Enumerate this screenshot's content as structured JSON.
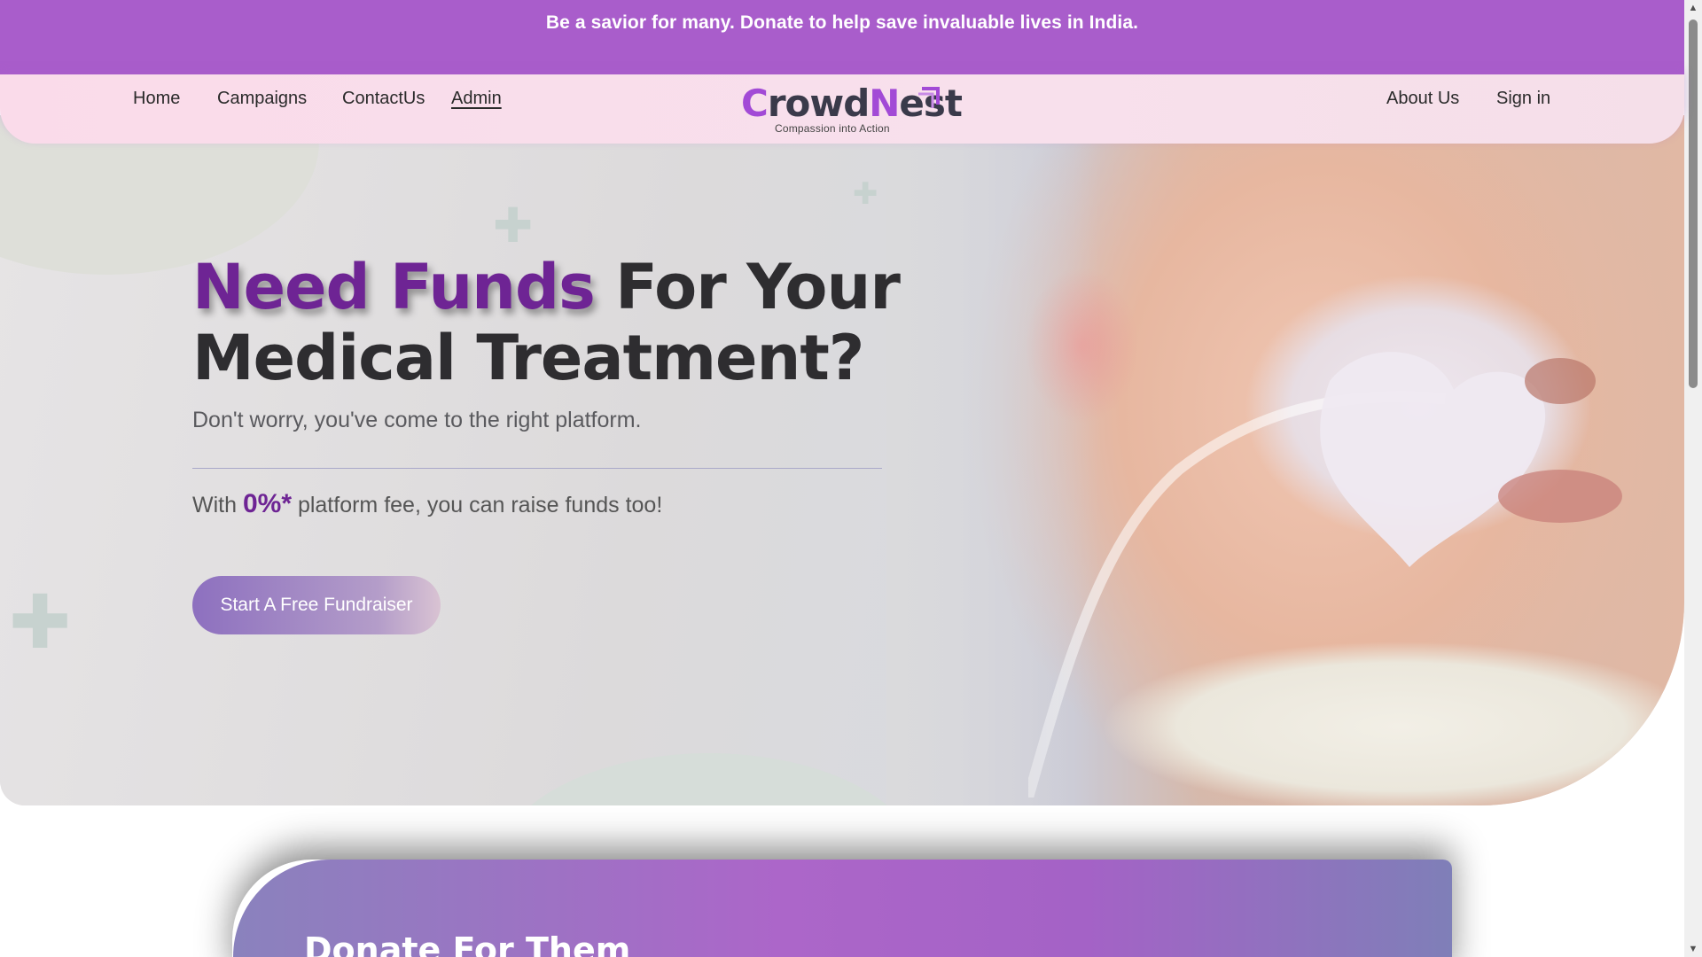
{
  "announcement": {
    "text": "Be a savior for many. Donate to help save invaluable lives in India."
  },
  "nav": {
    "left": [
      {
        "label": "Home"
      },
      {
        "label": "Campaigns"
      },
      {
        "label": "ContactUs"
      },
      {
        "label": "Admin",
        "active": true
      }
    ],
    "right": [
      {
        "label": "About Us"
      },
      {
        "label": "Sign in"
      }
    ]
  },
  "logo": {
    "c": "C",
    "rowd": "rowd",
    "n": "N",
    "est": "est",
    "tagline": "Compassion into Action"
  },
  "hero": {
    "title_accent": "Need Funds",
    "title_rest_1": " For Your",
    "title_line2": "Medical Treatment?",
    "subtitle": "Don't worry, you've come to the right platform.",
    "fee_prefix": "With ",
    "fee_value": "0%*",
    "fee_suffix": " platform fee, you can raise funds too!",
    "cta": "Start A Free Fundraiser"
  },
  "donate": {
    "title": "Donate For Them"
  },
  "colors": {
    "brand_purple": "#a95dcb",
    "accent_dark_purple": "#6e2494",
    "navbar_pink": "#fadbea"
  },
  "icons": {
    "scroll_up": "▲",
    "scroll_down": "▼",
    "plus": "✚"
  }
}
